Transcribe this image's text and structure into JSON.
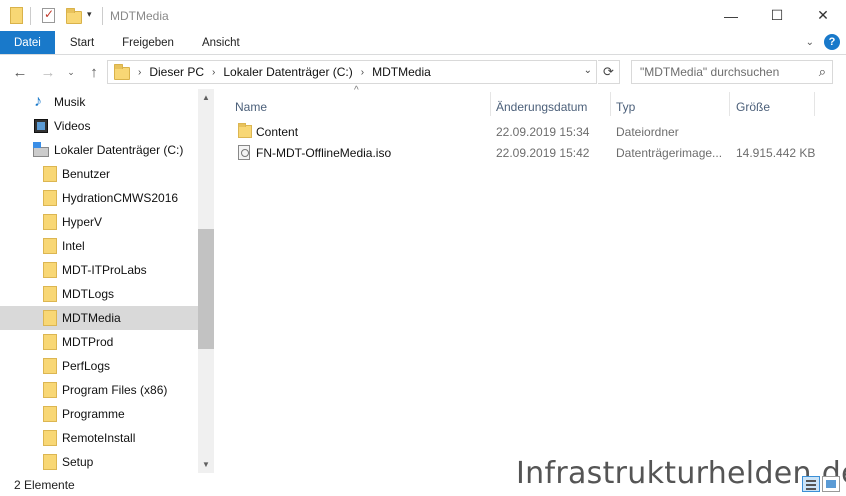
{
  "window": {
    "title": "MDTMedia",
    "minimize_glyph": "—",
    "maximize_glyph": "☐",
    "close_glyph": "✕"
  },
  "quick_access": {
    "dropdown_glyph": "▾"
  },
  "ribbon": {
    "tabs": [
      {
        "label": "Datei",
        "active": true
      },
      {
        "label": "Start"
      },
      {
        "label": "Freigeben"
      },
      {
        "label": "Ansicht"
      }
    ],
    "collapse_glyph": "⌄",
    "help_glyph": "?"
  },
  "navigation": {
    "back_glyph": "←",
    "forward_glyph": "→",
    "recent_glyph": "⌄",
    "up_glyph": "↑"
  },
  "address": {
    "breadcrumbs": [
      "Dieser PC",
      "Lokaler Datenträger (C:)",
      "MDTMedia"
    ],
    "separator": "›",
    "dropdown_glyph": "⌄",
    "refresh_glyph": "⟳"
  },
  "search": {
    "placeholder": "\"MDTMedia\" durchsuchen",
    "icon": "search-icon",
    "glyph": "⌕"
  },
  "nav_pane": {
    "items": [
      {
        "label": "Musik",
        "icon": "music-icon",
        "level": 1
      },
      {
        "label": "Videos",
        "icon": "videos-icon",
        "level": 1
      },
      {
        "label": "Lokaler Datenträger (C:)",
        "icon": "drive-icon",
        "level": 1
      },
      {
        "label": "Benutzer",
        "icon": "folder-icon",
        "level": 2
      },
      {
        "label": "HydrationCMWS2016",
        "icon": "folder-icon",
        "level": 2
      },
      {
        "label": "HyperV",
        "icon": "folder-icon",
        "level": 2
      },
      {
        "label": "Intel",
        "icon": "folder-icon",
        "level": 2
      },
      {
        "label": "MDT-ITProLabs",
        "icon": "folder-icon",
        "level": 2
      },
      {
        "label": "MDTLogs",
        "icon": "folder-icon",
        "level": 2
      },
      {
        "label": "MDTMedia",
        "icon": "folder-icon",
        "level": 2,
        "selected": true
      },
      {
        "label": "MDTProd",
        "icon": "folder-icon",
        "level": 2
      },
      {
        "label": "PerfLogs",
        "icon": "folder-icon",
        "level": 2
      },
      {
        "label": "Program Files (x86)",
        "icon": "folder-icon",
        "level": 2
      },
      {
        "label": "Programme",
        "icon": "folder-icon",
        "level": 2
      },
      {
        "label": "RemoteInstall",
        "icon": "folder-icon",
        "level": 2
      },
      {
        "label": "Setup",
        "icon": "folder-icon",
        "level": 2
      }
    ],
    "music_glyph": "♪",
    "scroll_up_glyph": "▲",
    "scroll_down_glyph": "▼"
  },
  "file_list": {
    "sort_glyph": "^",
    "columns": {
      "name": "Name",
      "date": "Änderungsdatum",
      "type": "Typ",
      "size": "Größe"
    },
    "rows": [
      {
        "name": "Content",
        "date": "22.09.2019 15:34",
        "type": "Dateiordner",
        "size": "",
        "icon": "folder-icon"
      },
      {
        "name": "FN-MDT-OfflineMedia.iso",
        "date": "22.09.2019 15:42",
        "type": "Datenträgerimage...",
        "size": "14.915.442 KB",
        "icon": "disc-image-icon"
      }
    ]
  },
  "status_bar": {
    "item_count": "2 Elemente"
  },
  "watermark": "Infrastrukturhelden.de",
  "colors": {
    "accent": "#1979ca",
    "selection": "#d9d9d9",
    "folder": "#f8d775",
    "column_header": "#4c607a",
    "meta_text": "#6d6d6d"
  }
}
